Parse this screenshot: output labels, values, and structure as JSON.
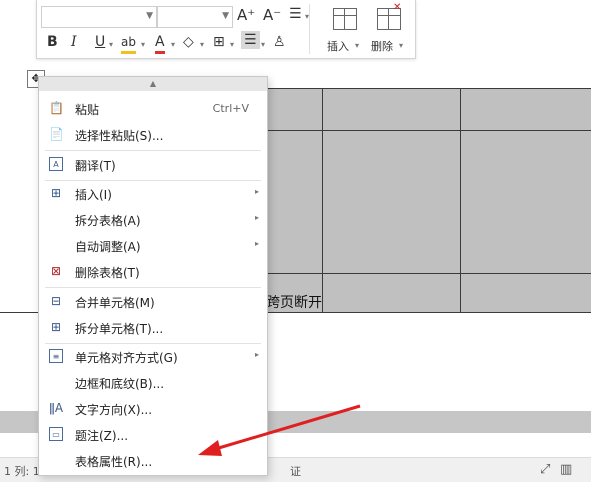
{
  "toolbar": {
    "font_name_value": "",
    "font_size_value": "",
    "grow_font_icon": "A⁺",
    "shrink_font_icon": "A⁻",
    "line_spacing_icon": "line-spacing-icon",
    "bold": "B",
    "italic": "I",
    "underline": "U",
    "highlight": "ab",
    "font_color": "A",
    "insert_label": "插入",
    "delete_label": "删除"
  },
  "document": {
    "page_break_text": "跨页断开",
    "cell_fill": "#c0c0c0"
  },
  "context_menu": {
    "items": [
      {
        "label": "粘贴",
        "shortcut": "Ctrl+V",
        "icon": "paste-icon"
      },
      {
        "label": "选择性粘贴(S)...",
        "icon": "paste-special-icon"
      },
      {
        "label": "翻译(T)",
        "icon": "translate-icon"
      },
      {
        "label": "插入(I)",
        "icon": "insert-table-icon",
        "submenu": true
      },
      {
        "label": "拆分表格(A)",
        "submenu": true
      },
      {
        "label": "自动调整(A)",
        "submenu": true
      },
      {
        "label": "删除表格(T)",
        "icon": "delete-table-icon"
      },
      {
        "label": "合并单元格(M)",
        "icon": "merge-cells-icon"
      },
      {
        "label": "拆分单元格(T)...",
        "icon": "split-cells-icon"
      },
      {
        "label": "单元格对齐方式(G)",
        "icon": "cell-align-icon",
        "submenu": true
      },
      {
        "label": "边框和底纹(B)..."
      },
      {
        "label": "文字方向(X)...",
        "icon": "text-direction-icon"
      },
      {
        "label": "题注(Z)...",
        "icon": "caption-icon"
      },
      {
        "label": "表格属性(R)..."
      }
    ]
  },
  "status_bar": {
    "text": "1   列: 1",
    "right_text": "证"
  },
  "colors": {
    "annotation_arrow": "#e02020"
  }
}
